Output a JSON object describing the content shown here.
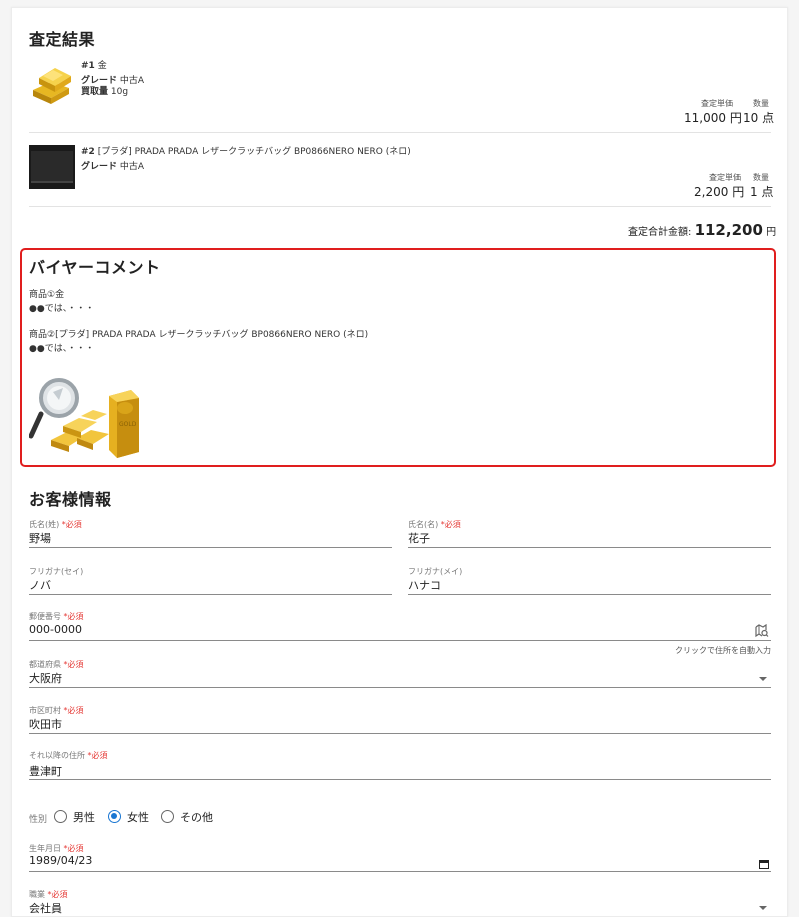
{
  "assessment": {
    "title": "査定結果",
    "items": [
      {
        "index": "#1",
        "name": "金",
        "grade_label": "グレード",
        "grade": "中古A",
        "amount_label": "買取量",
        "amount": "10g",
        "unit_price_label": "査定単価",
        "qty_label": "数量",
        "unit_price": "11,000",
        "yen": "円",
        "qty": "10",
        "qty_unit": "点"
      },
      {
        "index": "#2",
        "name": "[プラダ] PRADA PRADA レザークラッチバッグ BP0866NERO NERO (ネロ)",
        "grade_label": "グレード",
        "grade": "中古A",
        "unit_price_label": "査定単価",
        "qty_label": "数量",
        "unit_price": "2,200",
        "yen": "円",
        "qty": "1",
        "qty_unit": "点"
      }
    ],
    "total_label": "査定合計金額:",
    "total": "112,200",
    "total_yen": "円"
  },
  "buyer_comment": {
    "title": "バイヤーコメント",
    "lines": [
      "商品①金",
      "●●では、・・・",
      "商品②[プラダ] PRADA PRADA レザークラッチバッグ BP0866NERO NERO (ネロ)",
      "●●では、・・・"
    ],
    "gold_bar_text": "GOLD"
  },
  "customer": {
    "title": "お客様情報",
    "required": "*必須",
    "last_name": {
      "label": "氏名(姓)",
      "value": "野場"
    },
    "first_name": {
      "label": "氏名(名)",
      "value": "花子"
    },
    "last_kana": {
      "label": "フリガナ(セイ)",
      "value": "ノバ"
    },
    "first_kana": {
      "label": "フリガナ(メイ)",
      "value": "ハナコ"
    },
    "postal": {
      "label": "郵便番号",
      "value": "000-0000",
      "hint": "クリックで住所を自動入力"
    },
    "prefecture": {
      "label": "都道府県",
      "value": "大阪府"
    },
    "city": {
      "label": "市区町村",
      "value": "吹田市"
    },
    "address": {
      "label": "それ以降の住所",
      "value": "豊津町"
    },
    "gender": {
      "label": "性別",
      "options": [
        "男性",
        "女性",
        "その他"
      ],
      "selected": "女性"
    },
    "birthday": {
      "label": "生年月日",
      "value": "1989/04/23"
    },
    "occupation": {
      "label": "職業",
      "value": "会社員"
    }
  },
  "colors": {
    "required": "#e53935",
    "highlight_border": "#e01e1e",
    "radio_selected": "#1976d2"
  }
}
